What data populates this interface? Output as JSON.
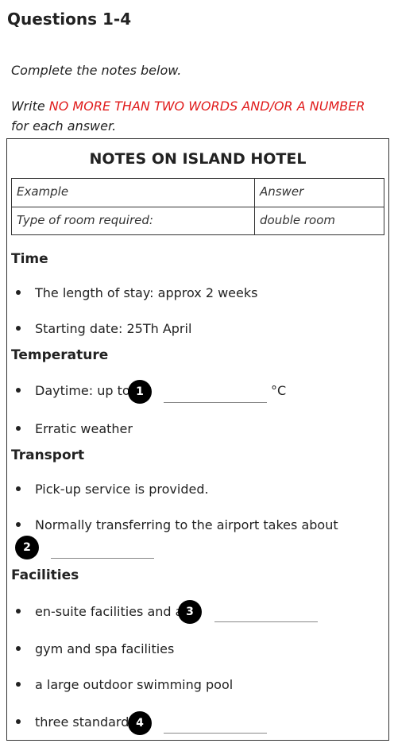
{
  "heading": "Questions 1-4",
  "instructions": {
    "line1": "Complete the notes below.",
    "line2_prefix": "Write",
    "line2_red": "NO MORE THAN TWO WORDS AND/OR A NUMBER",
    "line3": "for each answer."
  },
  "notes": {
    "title": "NOTES ON ISLAND HOTEL",
    "example_table": {
      "headers": [
        "Example",
        "Answer"
      ],
      "row": [
        "Type of room required:",
        "double room"
      ]
    },
    "sections": [
      {
        "title": "Time",
        "items": [
          "The length of stay: approx 2 weeks",
          "Starting date: 25Th April"
        ]
      },
      {
        "title": "Temperature",
        "items": [
          "Daytime: up to",
          "Erratic weather"
        ],
        "unit": "°C"
      },
      {
        "title": "Transport",
        "items": [
          "Pick-up service is provided.",
          "Normally transferring to the airport takes about"
        ]
      },
      {
        "title": "Facilities",
        "items": [
          "en-suite facilities and a",
          "gym and spa facilities",
          "a large outdoor swimming pool",
          "three standard"
        ]
      }
    ]
  },
  "question_numbers": [
    "1",
    "2",
    "3",
    "4"
  ]
}
